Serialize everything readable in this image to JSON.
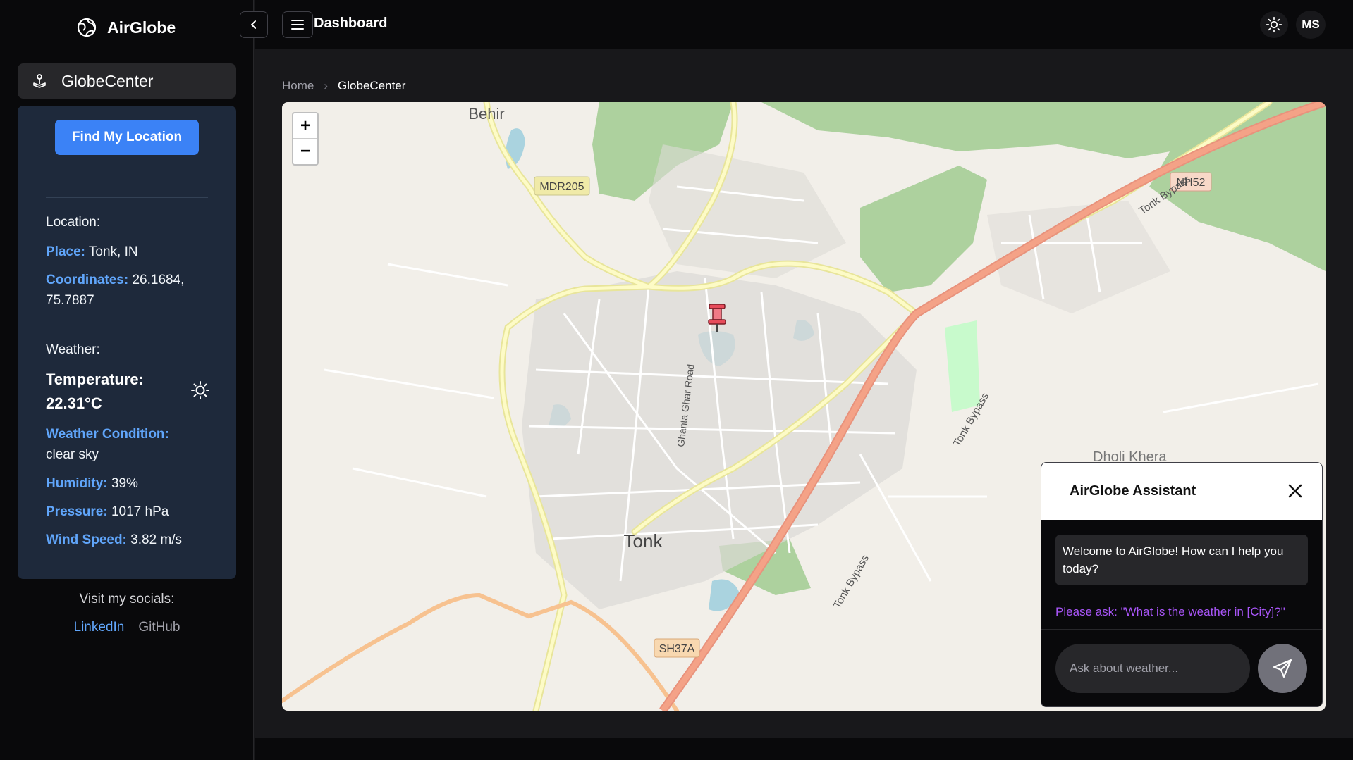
{
  "app": {
    "name": "AirGlobe"
  },
  "sidebar": {
    "nav_item": "GlobeCenter",
    "find_button": "Find My Location",
    "location": {
      "title": "Location:",
      "place_label": "Place:",
      "place_value": "Tonk, IN",
      "coords_label": "Coordinates:",
      "coords_value": "26.1684, 75.7887"
    },
    "weather": {
      "title": "Weather:",
      "temperature": "Temperature: 22.31°C",
      "condition_label": "Weather Condition:",
      "condition_value": "clear sky",
      "humidity_label": "Humidity:",
      "humidity_value": "39%",
      "pressure_label": "Pressure:",
      "pressure_value": "1017 hPa",
      "wind_label": "Wind Speed:",
      "wind_value": "3.82 m/s"
    },
    "socials_title": "Visit my socials:",
    "socials": {
      "linkedin": "LinkedIn",
      "github": "GitHub"
    }
  },
  "header": {
    "title": "Dashboard",
    "avatar_initials": "MS"
  },
  "breadcrumb": {
    "home": "Home",
    "separator": "›",
    "current": "GlobeCenter"
  },
  "map": {
    "zoom_in": "+",
    "zoom_out": "−",
    "labels": {
      "behir": "Behir",
      "mdr205": "MDR205",
      "nh52": "NH52",
      "tonk_bypass_1": "Tonk Bypass",
      "tonk_bypass_2": "Tonk Bypass",
      "tonk_bypass_3": "Tonk Bypass",
      "ghanta_ghar_road": "Ghanta Ghar Road",
      "tonk": "Tonk",
      "sh37a": "SH37A",
      "dholi_khera": "Dholi Khera"
    }
  },
  "chat": {
    "title": "AirGlobe Assistant",
    "welcome": "Welcome to AirGlobe! How can I help you today?",
    "hint": "Please ask: \"What is the weather in [City]?\"",
    "input_placeholder": "Ask about weather..."
  },
  "colors": {
    "accent": "#3b82f6",
    "label_blue": "#60a5fa",
    "hint_purple": "#a855f7",
    "panel": "#1e293b",
    "map_land": "#f2efe9",
    "road_yellow": "#f6f9a8",
    "highway": "#f4a287"
  },
  "icons": {
    "brand": "globe-icon",
    "nav": "joystick-icon",
    "collapse": "chevron-left-icon",
    "menu": "menu-icon",
    "theme": "sun-icon",
    "weather": "sun-icon",
    "pin": "map-pin-icon",
    "close": "close-icon",
    "send": "send-icon"
  }
}
